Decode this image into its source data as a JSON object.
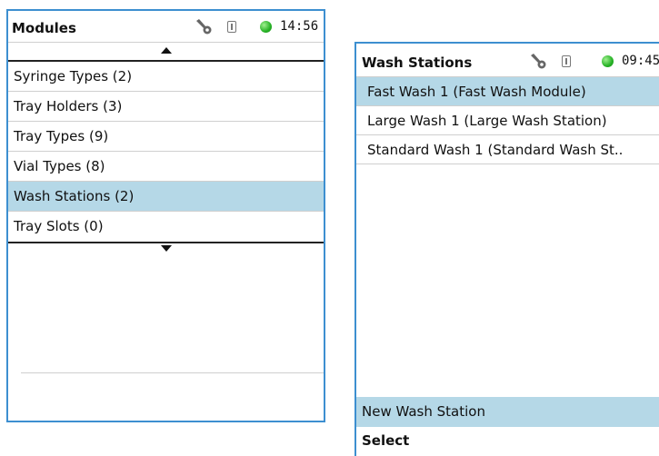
{
  "colors": {
    "frame_border": "#3d8fd0",
    "selection": "#b5d8e7",
    "status_led": "#26b125"
  },
  "left_screen": {
    "title": "Modules",
    "time": "14:56",
    "icons": [
      "wrench-icon",
      "usb-icon",
      "status-led-icon"
    ],
    "items": [
      {
        "label": "Syringe Types  (2)",
        "selected": false
      },
      {
        "label": "Tray Holders (3)",
        "selected": false
      },
      {
        "label": "Tray Types (9)",
        "selected": false
      },
      {
        "label": "Vial Types (8)",
        "selected": false
      },
      {
        "label": "Wash Stations (2)",
        "selected": true
      },
      {
        "label": "Tray Slots (0)",
        "selected": false
      }
    ]
  },
  "right_screen": {
    "title": "Wash Stations",
    "time": "09:45",
    "icons": [
      "wrench-icon",
      "usb-icon",
      "status-led-icon"
    ],
    "items": [
      {
        "label": "Fast Wash 1 (Fast Wash Module)",
        "selected": true
      },
      {
        "label": "Large Wash 1 (Large Wash Station)",
        "selected": false
      },
      {
        "label": "Standard Wash 1 (Standard Wash St..",
        "selected": false
      }
    ],
    "new_button": "New Wash Station",
    "softkey_label": "Select"
  }
}
